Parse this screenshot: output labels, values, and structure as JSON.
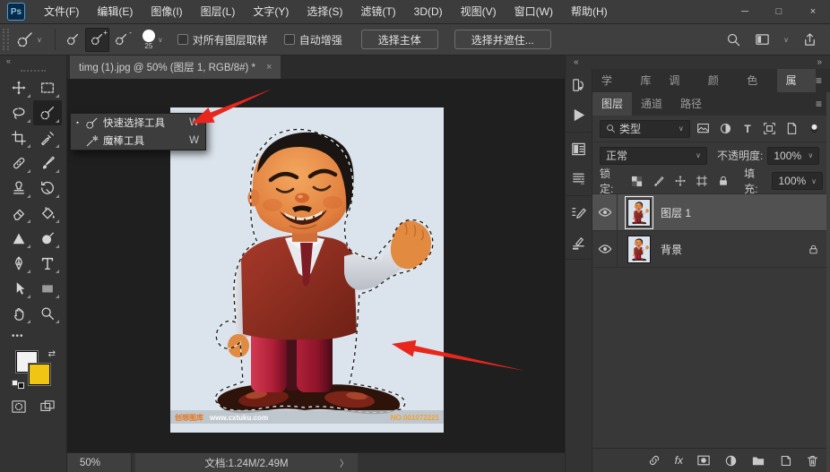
{
  "titlebar": {
    "logo": "Ps",
    "menus": [
      "文件(F)",
      "编辑(E)",
      "图像(I)",
      "图层(L)",
      "文字(Y)",
      "选择(S)",
      "滤镜(T)",
      "3D(D)",
      "视图(V)",
      "窗口(W)",
      "帮助(H)"
    ]
  },
  "icons": {
    "minimize": "─",
    "maximize": "□",
    "close": "×",
    "chevron": "∨",
    "hamburger": "≡",
    "collapse": "«",
    "expand": "»",
    "ellipsis": "•••",
    "swap": "⇄",
    "arrow": "&gt;",
    "bullet": "▪"
  },
  "options": {
    "brush_size": "25",
    "sample_all_layers": "对所有图层取样",
    "auto_enhance": "自动增强",
    "select_subject": "选择主体",
    "select_and_mask": "选择并遮住..."
  },
  "document": {
    "tab_title": "timg (1).jpg @ 50% (图层 1, RGB/8#) *",
    "zoom": "50%",
    "doc_info": "文档:1.24M/2.49M",
    "chevron": "〉"
  },
  "tool_flyout": {
    "item1": {
      "label": "快速选择工具",
      "shortcut": "W"
    },
    "item2": {
      "label": "魔棒工具",
      "shortcut": "W"
    }
  },
  "watermark": {
    "brand": "创想图库",
    "url": "www.cxtuku.com",
    "number": "NO.001072221"
  },
  "dock": {
    "tabs_top": [
      "学习",
      "库",
      "调整",
      "颜色",
      "色板",
      "属性"
    ],
    "tabs_layers": [
      "图层",
      "通道",
      "路径"
    ],
    "filter_type": "类型",
    "blend_mode": "正常",
    "opacity_label": "不透明度:",
    "opacity_value": "100%",
    "lock_label": "锁定:",
    "fill_label": "填充:",
    "fill_value": "100%",
    "fx_label": "fx",
    "layers": [
      {
        "name": "图层 1",
        "selected": true,
        "locked": false
      },
      {
        "name": "背景",
        "selected": false,
        "locked": true
      }
    ]
  },
  "colors": {
    "arrow_red": "#e8261c",
    "accent_blue": "#3ba0e8",
    "foreground_swatch": "#f2f2f2",
    "background_swatch": "#f0c514",
    "photo_background": "#dbe4ec"
  }
}
